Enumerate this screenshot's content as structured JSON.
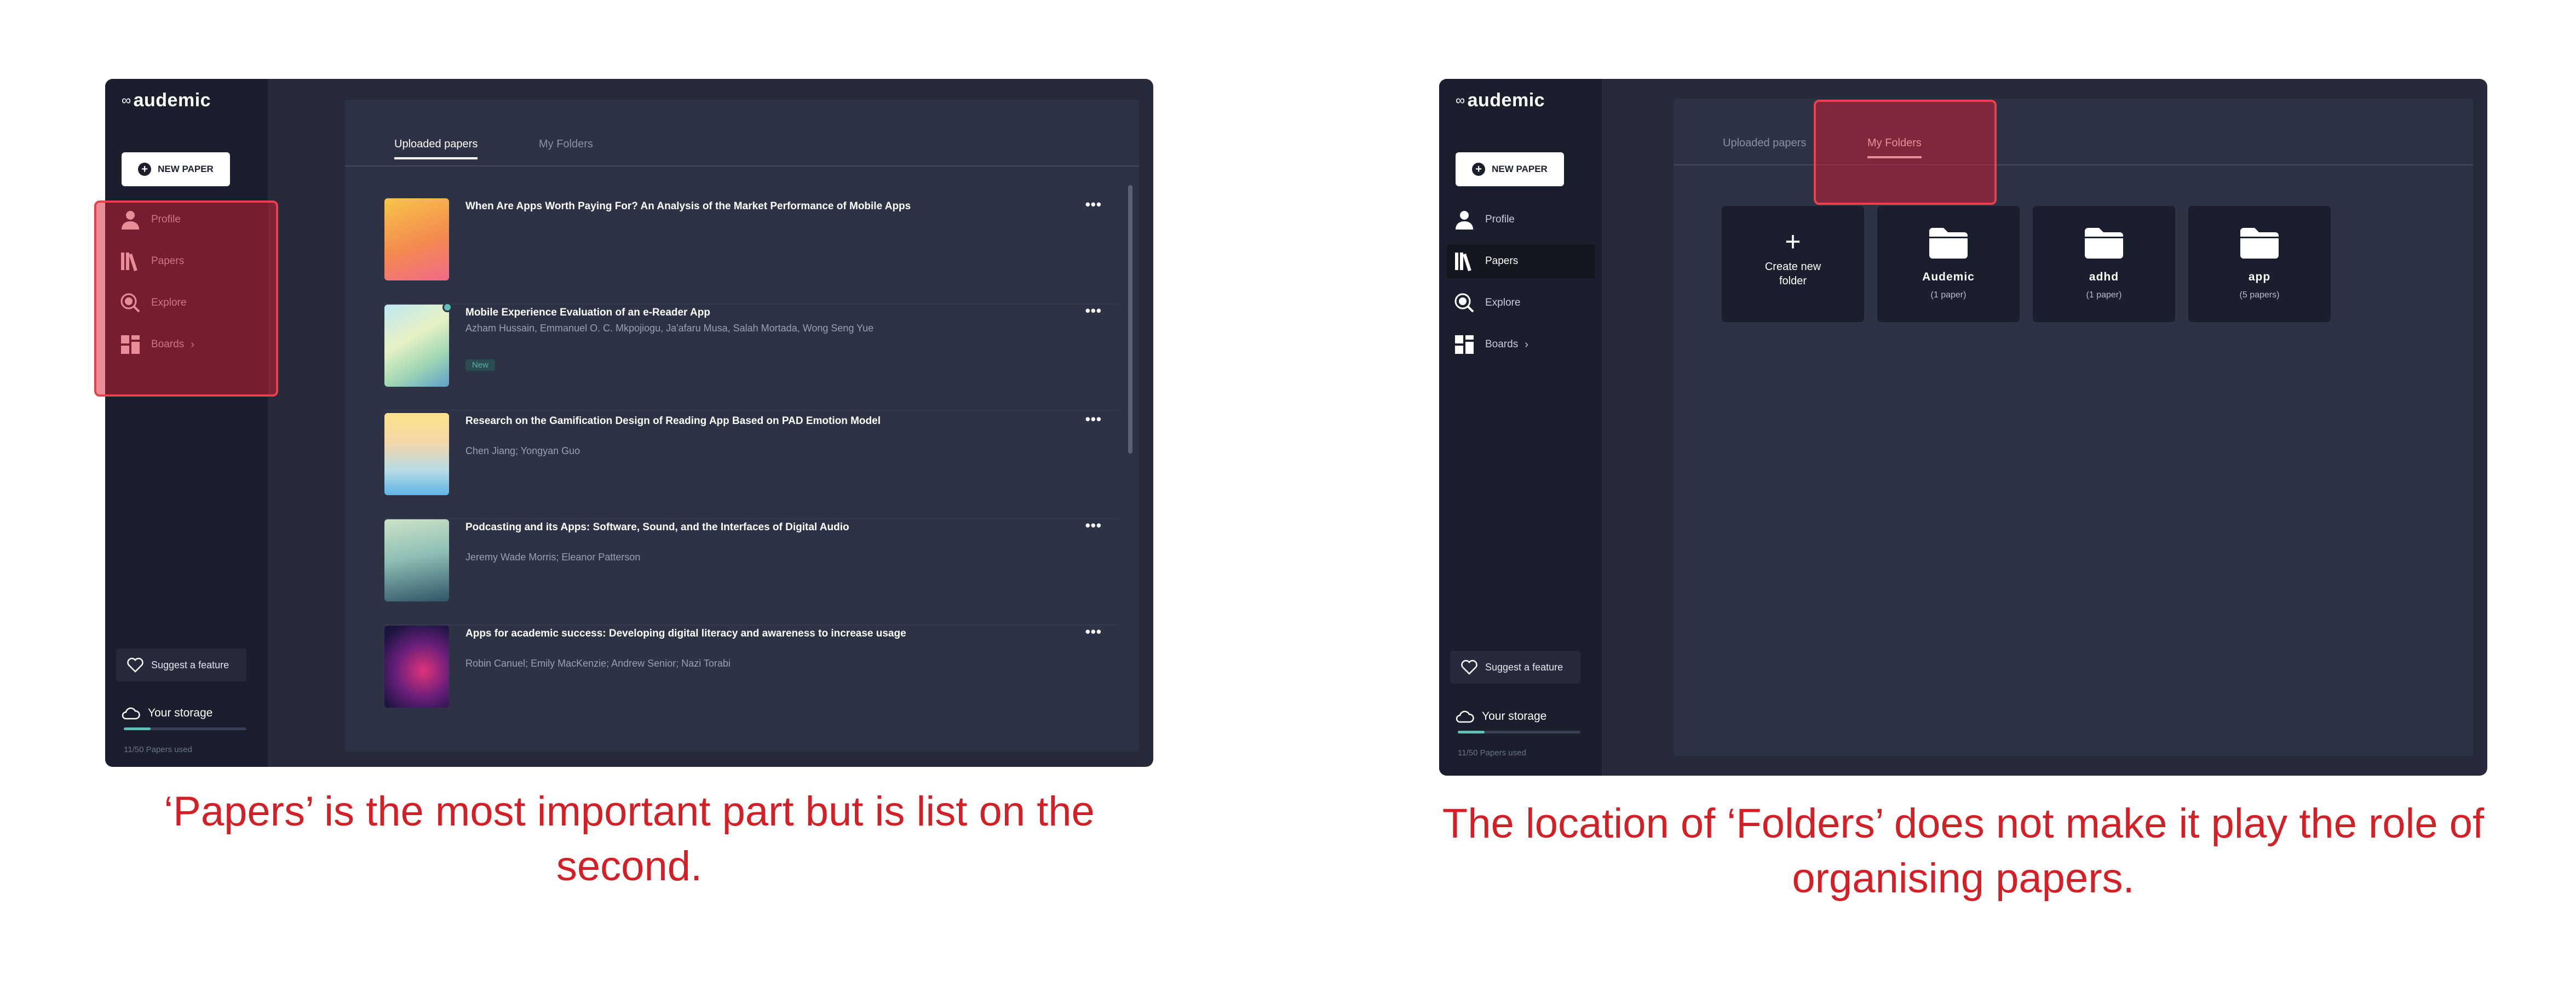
{
  "app": {
    "logo_symbol": "∞",
    "logo": "audemic"
  },
  "sidebar": {
    "new_paper": "NEW PAPER",
    "items": [
      {
        "label": "Profile",
        "icon": "user-icon"
      },
      {
        "label": "Papers",
        "icon": "books-icon"
      },
      {
        "label": "Explore",
        "icon": "explore-icon"
      },
      {
        "label": "Boards",
        "icon": "boards-icon",
        "chevron": "›"
      }
    ],
    "suggest": "Suggest a feature",
    "storage_label": "Your storage",
    "storage_used": "11/50 Papers used",
    "storage_fraction": 0.22
  },
  "left_screen": {
    "tabs": [
      "Uploaded papers",
      "My Folders"
    ],
    "active_tab": "Uploaded papers",
    "more_icon": "•••",
    "papers": [
      {
        "title": "When Are Apps Worth Paying For? An Analysis of the Market Performance of Mobile Apps",
        "authors": ""
      },
      {
        "title": "Mobile Experience Evaluation of an e-Reader App",
        "authors": "Azham Hussain, Emmanuel O. C. Mkpojiogu, Ja'afaru Musa, Salah Mortada, Wong Seng Yue",
        "badge": "New"
      },
      {
        "title": "Research on the Gamification Design of Reading App Based on PAD Emotion Model",
        "authors": "Chen Jiang; Yongyan Guo"
      },
      {
        "title": "Podcasting and its Apps: Software, Sound, and the Interfaces of Digital Audio",
        "authors": "Jeremy Wade Morris; Eleanor Patterson"
      },
      {
        "title": "Apps for academic success: Developing digital literacy and awareness to increase usage",
        "authors": "Robin Canuel; Emily MacKenzie; Andrew Senior; Nazi Torabi"
      }
    ]
  },
  "right_screen": {
    "tabs": [
      "Uploaded papers",
      "My Folders"
    ],
    "active_tab": "My Folders",
    "create_plus": "+",
    "create_folder": "Create new folder",
    "folders": [
      {
        "name": "Audemic",
        "count": "(1 paper)"
      },
      {
        "name": "adhd",
        "count": "(1 paper)"
      },
      {
        "name": "app",
        "count": "(5 papers)"
      }
    ]
  },
  "captions": {
    "left": "‘Papers’ is the most important part but is list on the second.",
    "right": "The location of ‘Folders’ does not make it play the role of organising papers."
  },
  "colors": {
    "highlight": "#e8404d",
    "caption": "#d31f26",
    "sidebar_bg": "#1b1e2c",
    "panel_bg": "#2d3244",
    "accent": "#5fc0b8"
  }
}
